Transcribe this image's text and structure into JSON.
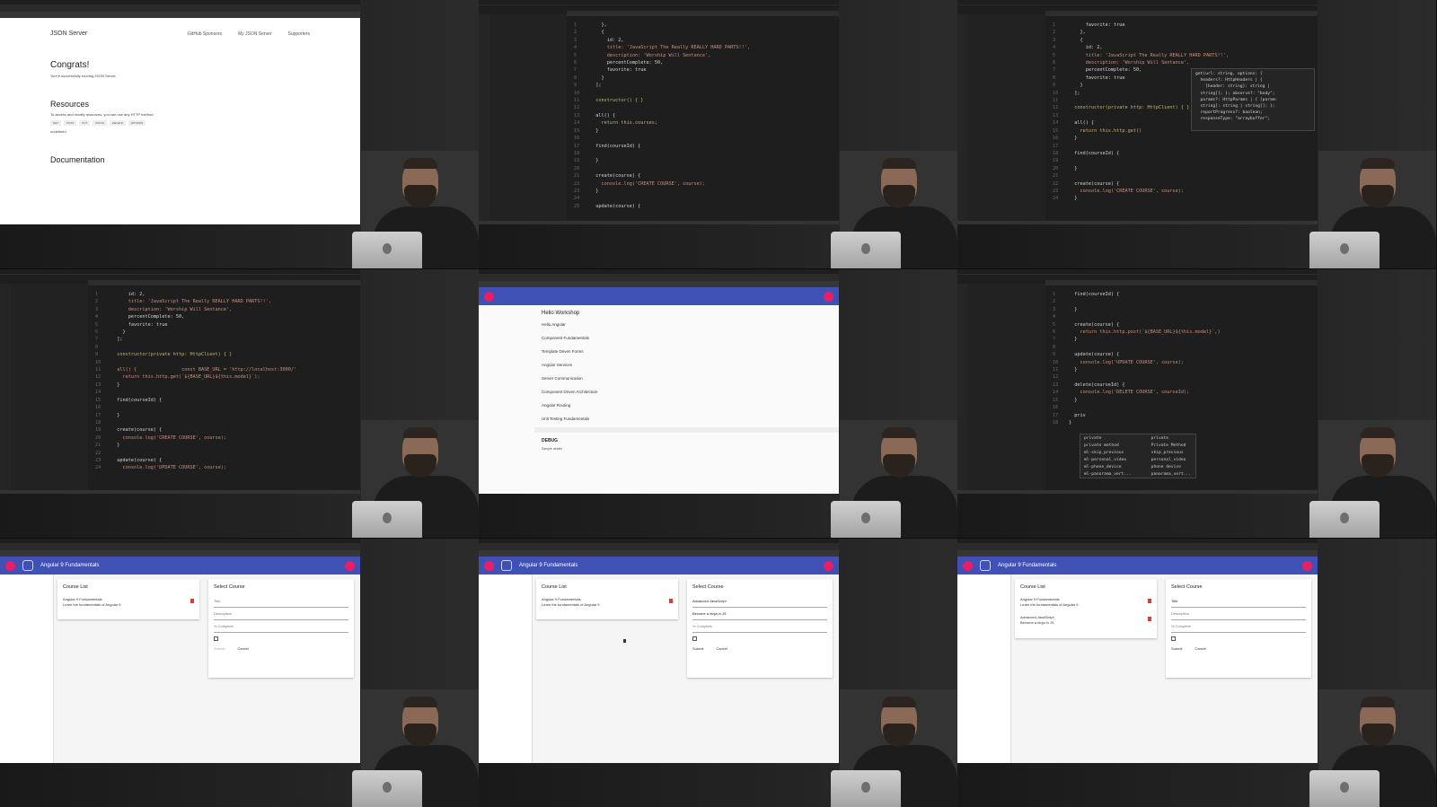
{
  "json_server": {
    "brand": "JSON Server",
    "links": [
      "GitHub Sponsors",
      "My JSON Server",
      "Supporters"
    ],
    "congrats": "Congrats!",
    "congrats_text": "You're successfully running JSON Server",
    "resources_title": "Resources",
    "resources_text": "To access and modify resources, you can use any HTTP method",
    "methods": [
      "GET",
      "POST",
      "PUT",
      "PATCH",
      "DELETE",
      "OPTIONS"
    ],
    "undefined_text": "undefined",
    "documentation_title": "Documentation"
  },
  "code_panel_2": [
    "    },",
    "    {",
    "      id: 2,",
    "      title: 'JavaScript The Really REALLY HARD PARTS!!',",
    "      description: 'Worship Will Sentance',",
    "      percentComplete: 50,",
    "      favorite: true",
    "    }",
    "  ];",
    "",
    "  constructor() { }",
    "",
    "  all() {",
    "    return this.courses;",
    "  }",
    "",
    "  find(courseId) {",
    "",
    "  }",
    "",
    "  create(course) {",
    "    console.log('CREATE COURSE', course);",
    "  }",
    "",
    "  update(course) {"
  ],
  "code_panel_3": [
    "      favorite: true",
    "    },",
    "    {",
    "      id: 2,",
    "      title: 'JavaScript The Really REALLY HARD PARTS!!',",
    "      description: 'Worship Will Sentance',",
    "      percentComplete: 50,",
    "      favorite: true",
    "    }",
    "  ];",
    "",
    "  constructor(private http: HttpClient) { }",
    "",
    "  all() {",
    "    return this.http.get()",
    "  }",
    "",
    "  find(courseId) {",
    "",
    "  }",
    "",
    "  create(course) {",
    "    console.log('CREATE COURSE', course);",
    "  }"
  ],
  "tooltip_3": [
    "get(url: string, options: {",
    "  headers?: HttpHeaders | {",
    "    [header: string]: string |",
    "  string[]; }; observe?: \"body\";",
    "  params?: HttpParams | { [param:",
    "  string]: string | string[]; };",
    "  reportProgress?: boolean;",
    "  responseType: \"arraybuffer\";"
  ],
  "code_panel_4": [
    "      id: 2,",
    "      title: 'JavaScript The Really REALLY HARD PARTS!!',",
    "      description: 'Worship Will Sentance',",
    "      percentComplete: 50,",
    "      favorite: true",
    "    }",
    "  ];",
    "",
    "  constructor(private http: HttpClient) { }",
    "",
    "  all() {                const BASE_URL = 'http://localhost:3000/'",
    "    return this.http.get(`${BASE_URL}${this.model}`);",
    "  }",
    "",
    "  find(courseId) {",
    "",
    "  }",
    "",
    "  create(course) {",
    "    console.log('CREATE COURSE', course);",
    "  }",
    "",
    "  update(course) {",
    "    console.log('UPDATE COURSE', course);"
  ],
  "code_panel_6": [
    "  find(courseId) {",
    "",
    "  }",
    "",
    "  create(course) {",
    "    return this.http.post(`${BASE_URL}${this.model}`,)",
    "  }",
    "",
    "  update(course) {",
    "    console.log('UPDATE COURSE', course);",
    "  }",
    "",
    "  delete(courseId) {",
    "    console.log('DELETE COURSE', courseId);",
    "  }",
    "",
    "  priv",
    "}"
  ],
  "suggest_6": [
    "private                    private",
    "private method             Private Method",
    "ml-skip_previous           skip_previous",
    "ml-personal_video          personal_video",
    "ml-phone_device            phone device",
    "ml-panorama_vert...        panorama_vert..."
  ],
  "workshop": {
    "title": "Hello Workshop",
    "items": [
      "Hello Angular",
      "Component Fundamentals",
      "Template Driven Forms",
      "Angular Services",
      "Server Communication",
      "Component Driven Architecture",
      "Angular Routing",
      "Unit Testing Fundamentals"
    ],
    "debug": "DEBUG",
    "debug_sub": "Sample details"
  },
  "app": {
    "title": "Angular 9 Fundamentals",
    "course_list_title": "Course List",
    "select_course_title": "Select Course",
    "course_1_title": "Angular 9 Fundamentals",
    "course_1_desc": "Learn the fundamentals of Angular 9",
    "course_2_title": "Advanced JavaScript",
    "course_2_desc": "Become a ninja in JS",
    "field_title": "Title",
    "field_description": "Description",
    "field_percent": "% Complete",
    "save_label": "Submit",
    "cancel_label": "Cancel",
    "panel8_title_value": "Advanced JavaScript",
    "panel8_desc_value": "Become a ninja in JS",
    "panel9_title_value": "Title"
  }
}
